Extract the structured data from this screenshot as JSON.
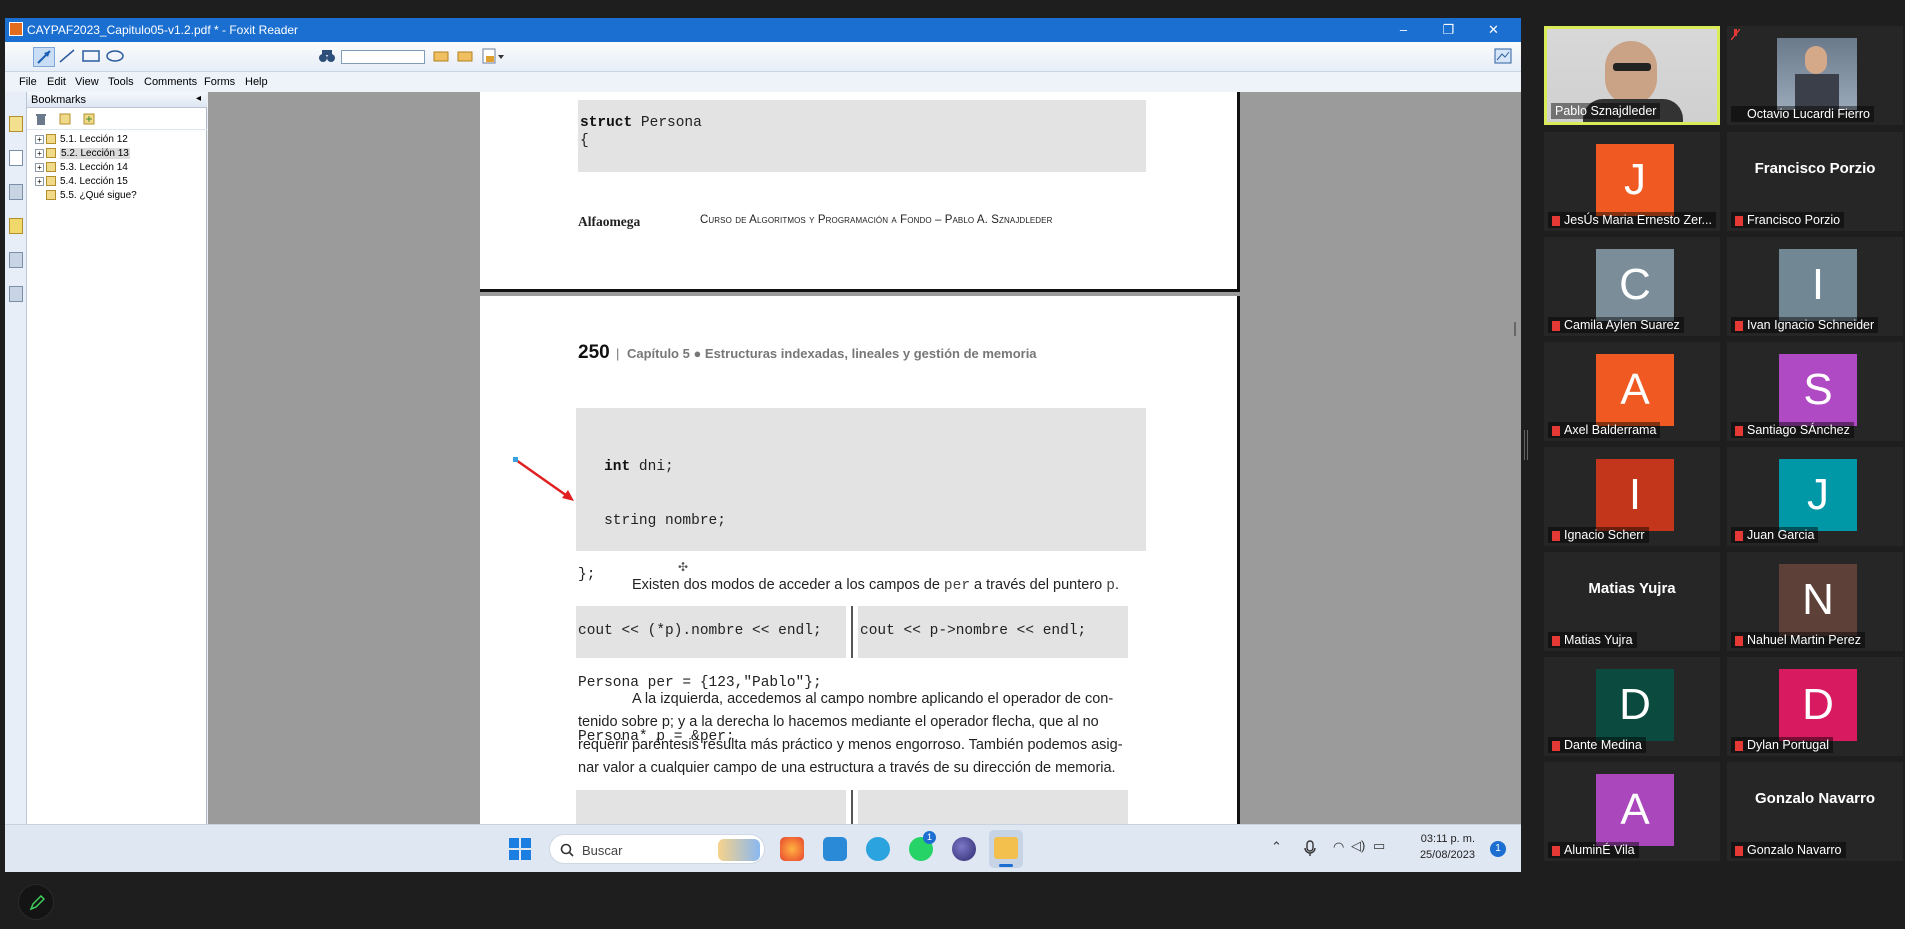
{
  "window": {
    "title": "CAYPAF2023_Capitulo05-v1.2.pdf * - Foxit Reader",
    "minimize": "–",
    "maximize": "❐",
    "close": "✕"
  },
  "menu": [
    "File",
    "Edit",
    "View",
    "Tools",
    "Comments",
    "Forms",
    "Help"
  ],
  "bookmarks": {
    "header": "Bookmarks",
    "items": [
      "5.1. Lección 12",
      "5.2. Lección 13",
      "5.3. Lección 14",
      "5.4. Lección 15",
      "5.5. ¿Qué sigue?"
    ],
    "selected_index": 1
  },
  "page1": {
    "code_line1_kw": "struct",
    "code_line1_rest": " Persona",
    "code_line2": "{",
    "footer_left": "Alfaomega",
    "footer_right": "Curso de Algoritmos y Programación a Fondo – Pablo A. Sznajdleder"
  },
  "page2": {
    "page_number": "250",
    "header_sep": "|",
    "chapter": "Capítulo 5 ● Estructuras indexadas, lineales y gestión de memoria",
    "code_block": [
      "   int dni;",
      "   string nombre;",
      "};",
      "",
      "Persona per = {123,\"Pablo\"};",
      "Persona* p = &per;"
    ],
    "para1_a": "Existen dos modos de acceder a los campos de ",
    "para1_mono": "per",
    "para1_b": " a través del puntero ",
    "para1_mono2": "p",
    "para1_c": ".",
    "code_left": "cout << (*p).nombre << endl;",
    "code_right": "cout << p->nombre << endl;",
    "para2_lines": [
      "A la izquierda, accedemos al campo nombre aplicando el operador de con-",
      "tenido sobre p; y a la derecha lo hacemos mediante el operador flecha, que al no",
      "requerir paréntesis resulta más práctico y menos engorroso. También podemos asig-",
      "nar valor a cualquier campo de una estructura a través de su dirección de memoria."
    ]
  },
  "taskbar": {
    "search_placeholder": "Buscar",
    "time": "03:11 p. m.",
    "date": "25/08/2023",
    "notif_count": "1",
    "whatsapp_badge": "1"
  },
  "participants": [
    {
      "name": "Pablo Sznajdleder",
      "type": "video",
      "active": true
    },
    {
      "name": "Octavio Lucardi Fierro",
      "type": "video"
    },
    {
      "name": "JesÚs Maria Ernesto Zer...",
      "letter": "J",
      "color": "#f05a22"
    },
    {
      "name": "Francisco Porzio",
      "big": "Francisco Porzio"
    },
    {
      "name": "Camila Aylen Suarez",
      "letter": "C",
      "color": "#7a8d99"
    },
    {
      "name": "Ivan Ignacio Schneider",
      "letter": "I",
      "color": "#718793"
    },
    {
      "name": "Axel Balderrama",
      "letter": "A",
      "color": "#f05a22"
    },
    {
      "name": "Santiago SÁnchez",
      "letter": "S",
      "color": "#b04ac4"
    },
    {
      "name": "Ignacio Scherr",
      "letter": "I",
      "color": "#c4361b"
    },
    {
      "name": "Juan Garcia",
      "letter": "J",
      "color": "#0097a7"
    },
    {
      "name": "Matias Yujra",
      "big": "Matias Yujra"
    },
    {
      "name": "Nahuel Martin Perez",
      "letter": "N",
      "color": "#5d4037"
    },
    {
      "name": "Dante Medina",
      "letter": "D",
      "color": "#0b4a3e"
    },
    {
      "name": "Dylan Portugal",
      "letter": "D",
      "color": "#d81b60"
    },
    {
      "name": "AluminÉ Vila",
      "letter": "A",
      "color": "#ab47bc"
    },
    {
      "name": "Gonzalo Navarro",
      "big": "Gonzalo Navarro"
    }
  ]
}
